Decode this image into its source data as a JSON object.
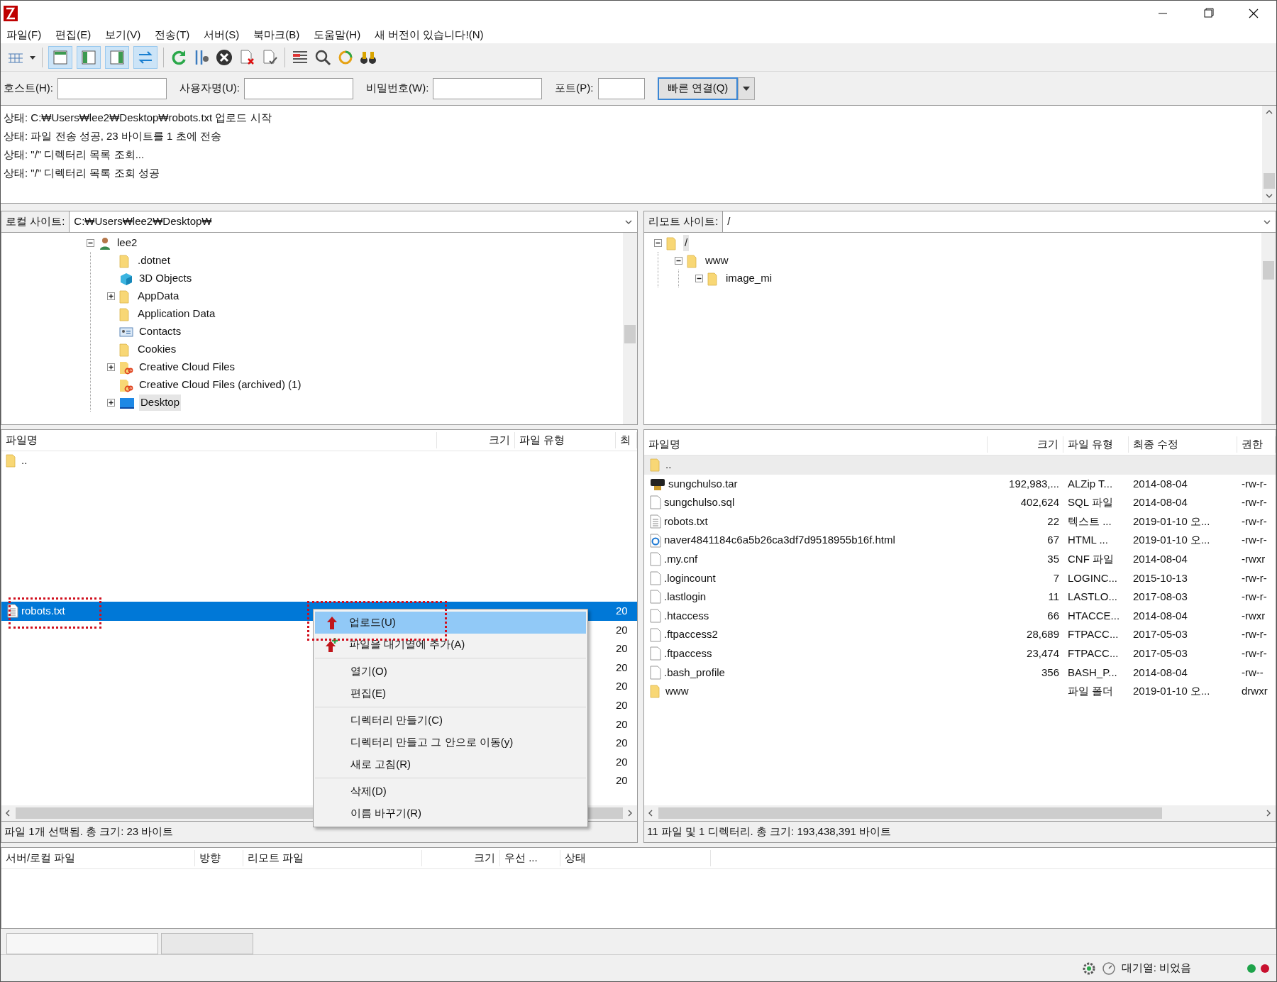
{
  "menu_bar": [
    {
      "label": "파일(F)"
    },
    {
      "label": "편집(E)"
    },
    {
      "label": "보기(V)"
    },
    {
      "label": "전송(T)"
    },
    {
      "label": "서버(S)"
    },
    {
      "label": "북마크(B)"
    },
    {
      "label": "도움말(H)"
    },
    {
      "label": "새 버전이 있습니다!(N)"
    }
  ],
  "toolbar": {
    "view_toggles": [
      {
        "selected": true
      },
      {
        "selected": true
      },
      {
        "selected": true
      },
      {
        "selected": true
      }
    ]
  },
  "quickconnect": {
    "fields": [
      {
        "label": "호스트(H):"
      },
      {
        "label": "사용자명(U):"
      },
      {
        "label": "비밀번호(W):"
      },
      {
        "label": "포트(P):"
      }
    ],
    "button": "빠른 연결(Q)"
  },
  "message_log": [
    "상태: C:₩Users₩lee2₩Desktop₩robots.txt 업로드 시작",
    "상태: 파일 전송 성공, 23 바이트를 1 초에 전송",
    "상태: \"/\" 디렉터리 목록 조회...",
    "상태: \"/\" 디렉터리 목록 조회 성공"
  ],
  "local_site": {
    "label": "로컬 사이트:",
    "path": "C:₩Users₩lee2₩Desktop₩"
  },
  "local_tree": [
    {
      "label": "lee2",
      "kind": "user",
      "expandable": true,
      "expanded": true,
      "selected": false,
      "children": [
        {
          "label": ".dotnet",
          "kind": "folder",
          "expandable": false,
          "selected": false
        },
        {
          "label": "3D Objects",
          "kind": "cube",
          "expandable": false,
          "selected": false
        },
        {
          "label": "AppData",
          "kind": "folder",
          "expandable": true,
          "expanded": false,
          "selected": false
        },
        {
          "label": "Application Data",
          "kind": "folder",
          "expandable": false,
          "selected": false
        },
        {
          "label": "Contacts",
          "kind": "contacts",
          "expandable": false,
          "selected": false
        },
        {
          "label": "Cookies",
          "kind": "folder",
          "expandable": false,
          "selected": false
        },
        {
          "label": "Creative Cloud Files",
          "kind": "cloud",
          "expandable": true,
          "expanded": false,
          "selected": false
        },
        {
          "label": "Creative Cloud Files (archived) (1)",
          "kind": "cloud",
          "expandable": false,
          "selected": false
        },
        {
          "label": "Desktop",
          "kind": "desktop",
          "expandable": true,
          "expanded": false,
          "selected": true
        }
      ]
    }
  ],
  "remote_site": {
    "label": "리모트 사이트:",
    "path": "/"
  },
  "remote_tree": [
    {
      "label": "/",
      "kind": "folder",
      "expandable": true,
      "expanded": true,
      "selected": true,
      "children": [
        {
          "label": "www",
          "kind": "folder",
          "expandable": true,
          "expanded": true,
          "selected": false,
          "children": [
            {
              "label": "image_mi",
              "kind": "folder",
              "expandable": true,
              "expanded": true,
              "selected": false
            }
          ]
        }
      ]
    }
  ],
  "local_list": {
    "columns": [
      "파일명",
      "크기",
      "파일 유형",
      "최"
    ],
    "top_rows": [
      {
        "name": "..",
        "kind": "parent",
        "selected": false
      }
    ],
    "rows": [
      {
        "name": "robots.txt",
        "kind": "text",
        "date": "20",
        "selected": true
      },
      {
        "date": "20",
        "selected": false
      },
      {
        "date": "20",
        "selected": false
      },
      {
        "date": "20",
        "selected": false
      },
      {
        "date": "20",
        "selected": false
      },
      {
        "date": "20",
        "selected": false
      },
      {
        "date": "20",
        "selected": false
      },
      {
        "date": "20",
        "selected": false
      },
      {
        "date": "20",
        "selected": false
      },
      {
        "date": "20",
        "selected": false
      }
    ],
    "status": "파일 1개 선택됨. 총 크기: 23 바이트"
  },
  "context_menu": [
    [
      {
        "label": "업로드(U)",
        "kind": "upload",
        "selected": true
      },
      {
        "label": "파일을 대기열에 추가(A)",
        "kind": "queue",
        "selected": false
      }
    ],
    [
      {
        "label": "열기(O)",
        "kind": "plain",
        "selected": false
      },
      {
        "label": "편집(E)",
        "kind": "plain",
        "selected": false
      }
    ],
    [
      {
        "label": "디렉터리 만들기(C)",
        "kind": "plain",
        "selected": false
      },
      {
        "label": "디렉터리 만들고 그 안으로 이동(y)",
        "kind": "plain",
        "selected": false
      },
      {
        "label": "새로 고침(R)",
        "kind": "plain",
        "selected": false
      }
    ],
    [
      {
        "label": "삭제(D)",
        "kind": "plain",
        "selected": false
      },
      {
        "label": "이름 바꾸기(R)",
        "kind": "plain",
        "selected": false
      }
    ]
  ],
  "remote_list": {
    "columns": [
      "파일명",
      "크기",
      "파일 유형",
      "최종 수정",
      "권한"
    ],
    "rows": [
      {
        "name": "..",
        "kind": "parent",
        "selected": true
      },
      {
        "name": "sungchulso.tar",
        "kind": "tar",
        "size": "192,983,...",
        "type": "ALZip T...",
        "modified": "2014-08-04",
        "perms": "-rw-r-",
        "selected": false
      },
      {
        "name": "sungchulso.sql",
        "kind": "file",
        "size": "402,624",
        "type": "SQL 파일",
        "modified": "2014-08-04",
        "perms": "-rw-r-",
        "selected": false
      },
      {
        "name": "robots.txt",
        "kind": "text",
        "size": "22",
        "type": "텍스트 ...",
        "modified": "2019-01-10 오...",
        "perms": "-rw-r-",
        "selected": false
      },
      {
        "name": "naver4841184c6a5b26ca3df7d9518955b16f.html",
        "kind": "html",
        "size": "67",
        "type": "HTML ...",
        "modified": "2019-01-10 오...",
        "perms": "-rw-r-",
        "selected": false
      },
      {
        "name": ".my.cnf",
        "kind": "file",
        "size": "35",
        "type": "CNF 파일",
        "modified": "2014-08-04",
        "perms": "-rwxr",
        "selected": false
      },
      {
        "name": ".logincount",
        "kind": "file",
        "size": "7",
        "type": "LOGINC...",
        "modified": "2015-10-13",
        "perms": "-rw-r-",
        "selected": false
      },
      {
        "name": ".lastlogin",
        "kind": "file",
        "size": "11",
        "type": "LASTLO...",
        "modified": "2017-08-03",
        "perms": "-rw-r-",
        "selected": false
      },
      {
        "name": ".htaccess",
        "kind": "file",
        "size": "66",
        "type": "HTACCE...",
        "modified": "2014-08-04",
        "perms": "-rwxr",
        "selected": false
      },
      {
        "name": ".ftpaccess2",
        "kind": "file",
        "size": "28,689",
        "type": "FTPACC...",
        "modified": "2017-05-03",
        "perms": "-rw-r-",
        "selected": false
      },
      {
        "name": ".ftpaccess",
        "kind": "file",
        "size": "23,474",
        "type": "FTPACC...",
        "modified": "2017-05-03",
        "perms": "-rw-r-",
        "selected": false
      },
      {
        "name": ".bash_profile",
        "kind": "file",
        "size": "356",
        "type": "BASH_P...",
        "modified": "2014-08-04",
        "perms": "-rw--",
        "selected": false
      },
      {
        "name": "www",
        "kind": "folder",
        "type": "파일 폴더",
        "modified": "2019-01-10 오...",
        "perms": "drwxr",
        "selected": false
      }
    ],
    "status": "11 파일 및 1 디렉터리. 총 크기: 193,438,391 바이트"
  },
  "queue": {
    "columns": [
      "서버/로컬 파일",
      "방향",
      "리모트 파일",
      "크기",
      "우선 ...",
      "상태"
    ]
  },
  "status_bar": {
    "queue": "대기열: 비었음"
  }
}
